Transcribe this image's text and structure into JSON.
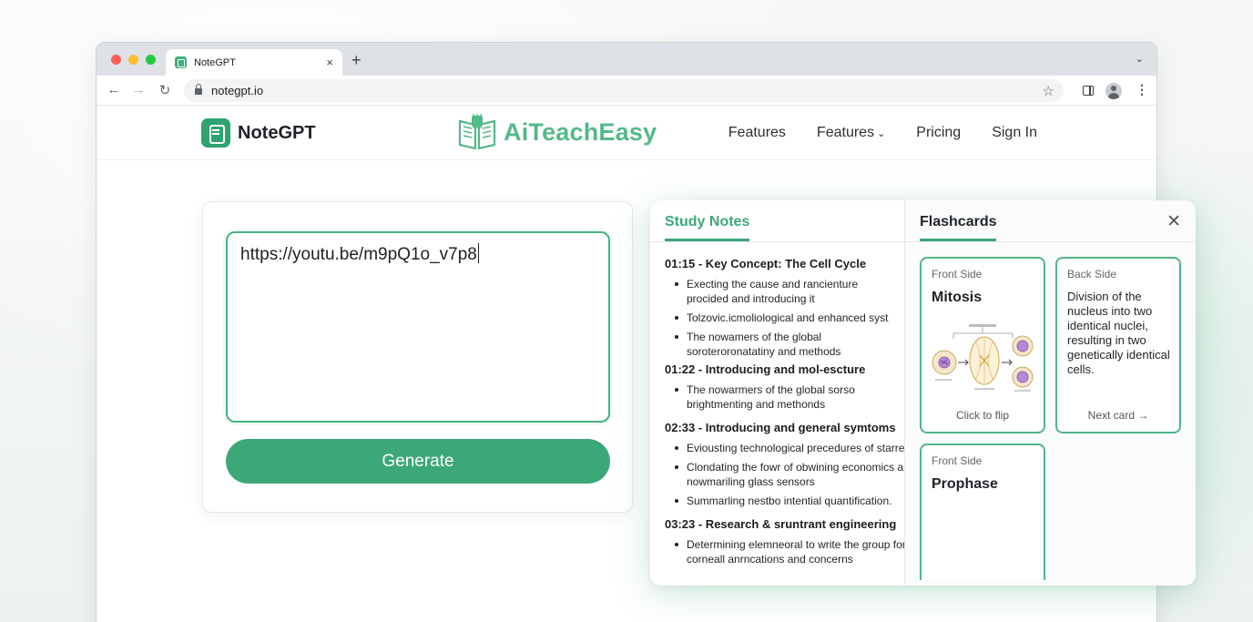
{
  "browser": {
    "tab_title": "NoteGPT",
    "tab_close": "×",
    "new_tab": "+",
    "tab_menu": "⌄",
    "back": "←",
    "forward": "→",
    "reload": "↻",
    "url": "notegpt.io",
    "star": "☆",
    "kebab": "⋮"
  },
  "site": {
    "brand": "NoteGPT",
    "center_logo": "AiTeachEasy",
    "nav": {
      "features_1": "Features",
      "features_2": "Features",
      "features_2_chevron": "⌄",
      "pricing": "Pricing",
      "sign_in": "Sign In"
    }
  },
  "input": {
    "url_value": "https://youtu.be/m9pQ1o_v7p8",
    "generate_label": "Generate"
  },
  "results": {
    "notes_tab": "Study Notes",
    "cards_tab": "Flashcards",
    "close": "✕",
    "sections": [
      {
        "title": "01:15 - Key Concept: The Cell Cycle",
        "items": [
          [
            "Execting the cause and rancienture",
            "procided and introducing it"
          ],
          [
            "Tolzovic.icmoliological and enhanced syst"
          ],
          [
            "The nowamers of the global",
            "soroteroronatatiny and methods"
          ]
        ]
      },
      {
        "title": "01:22 - Introducing and mol-escture",
        "items": [
          [
            "The nowarmers of the global sorso",
            "brightmenting and methonds"
          ]
        ]
      },
      {
        "title": "02:33 - Introducing and general symtoms",
        "items": [
          [
            "Eviousting technological precedures of starres"
          ],
          [
            "Clondating the fowr of obwining economics ar",
            "nowmariling glass sensors"
          ],
          [
            "Summarling nestbo intential quantification."
          ]
        ]
      },
      {
        "title": "03:23 - Research & sruntrant engineering",
        "items": [
          [
            "Determining elemneoral to write the group for",
            "corneall anrncations and concerns"
          ]
        ]
      }
    ],
    "cards": [
      {
        "label": "Front Side",
        "term": "Mitosis",
        "footer": "Click to flip"
      },
      {
        "label": "Back Side",
        "definition": "Division of the nucleus into two identical nuclei, resulting in two genetically identical cells.",
        "footer": "Next card →"
      },
      {
        "label": "Front Side",
        "term": "Prophase"
      }
    ]
  },
  "colors": {
    "accent": "#3ca878",
    "logo_green": "#55b98a",
    "browser_chrome": "#dee1e6"
  }
}
